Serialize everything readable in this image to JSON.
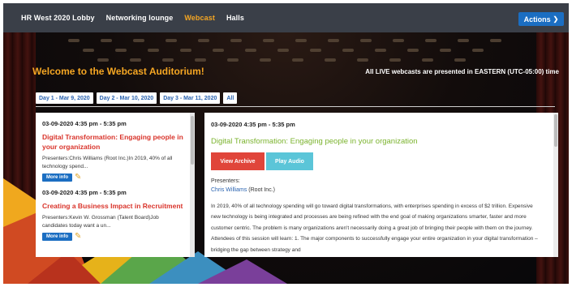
{
  "nav": {
    "items": [
      "HR West 2020 Lobby",
      "Networking lounge",
      "Webcast",
      "Halls"
    ],
    "active": "Webcast",
    "actions_label": "Actions"
  },
  "page": {
    "welcome": "Welcome to the Webcast Auditorium!",
    "live_note": "All LIVE webcasts are presented in EASTERN (UTC-05:00) time"
  },
  "day_tabs": [
    "Day 1 - Mar 9, 2020",
    "Day 2 - Mar 10, 2020",
    "Day 3 - Mar 11, 2020",
    "All"
  ],
  "sessions": [
    {
      "time": "03-09-2020   4:35 pm - 5:35 pm",
      "title": "Digital Transformation: Engaging people in your organization",
      "desc": "Presenters:Chris Williams (Root Inc.)In 2019, 40% of all technology spend...",
      "more": "More info"
    },
    {
      "time": "03-09-2020   4:35 pm - 5:35 pm",
      "title": "Creating a Business Impact in Recruitment",
      "desc": "Presenters:Kevin W. Grossman (Talent Board)Job candidates today want a un...",
      "more": "More info"
    }
  ],
  "detail": {
    "time": "03-09-2020   4:35 pm - 5:35 pm",
    "title": "Digital Transformation: Engaging people in your organization",
    "view_archive": "View Archive",
    "play_audio": "Play Audio",
    "presenters_label": "Presenters:",
    "presenter_name": "Chris Williams",
    "presenter_org": " (Root Inc.)",
    "description": "In 2019, 40% of all technology spending will go toward digital transformations, with enterprises spending in excess of $2 trillion. Expensive new technology is being integrated and processes are being refined with the end goal of making organizations smarter, faster and more customer centric. The problem is many organizations aren't necessarily doing a great job of bringing their people with them on the journey. Attendees of this session will learn: 1. The major components to successfully engage your entire organization in your digital transformation – bridging the gap between strategy and"
  },
  "colors": {
    "nav_bg": "#3a3f48",
    "accent_orange": "#f5a623",
    "action_blue": "#1b6ec2",
    "title_red": "#d9342b",
    "title_green": "#7bb32e",
    "archive_red": "#e0453a",
    "audio_cyan": "#5bc5d8"
  },
  "icons": {
    "actions_chevron": "chevron-down-icon",
    "edit": "pencil-icon"
  }
}
